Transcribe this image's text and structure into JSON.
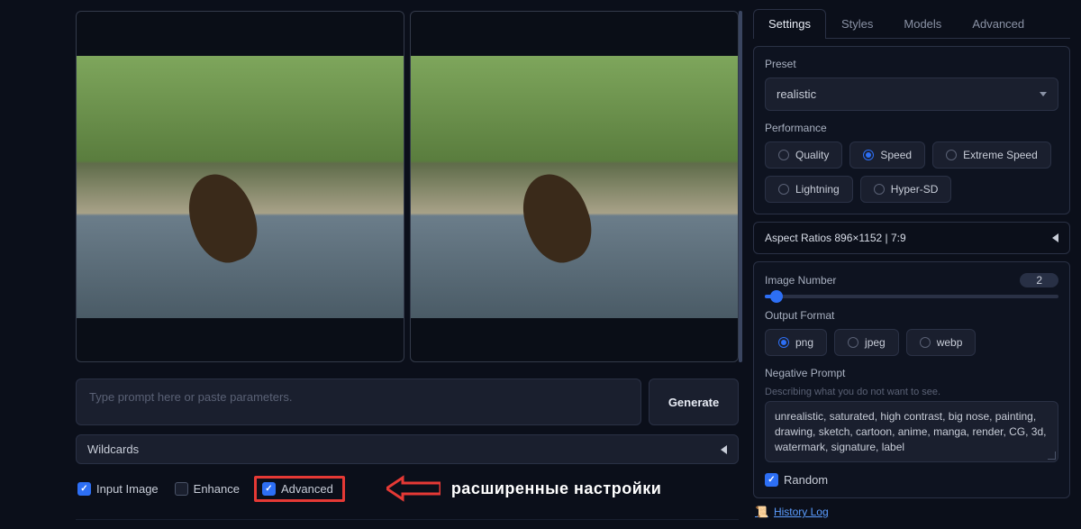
{
  "prompt": {
    "placeholder": "Type prompt here or paste parameters.",
    "generate_label": "Generate"
  },
  "wildcards_label": "Wildcards",
  "checkboxes": {
    "input_image": "Input Image",
    "enhance": "Enhance",
    "advanced": "Advanced"
  },
  "annotation": {
    "text": "расширенные настройки"
  },
  "right_tabs": [
    "Settings",
    "Styles",
    "Models",
    "Advanced"
  ],
  "preset": {
    "label": "Preset",
    "value": "realistic"
  },
  "performance": {
    "label": "Performance",
    "options": [
      "Quality",
      "Speed",
      "Extreme Speed",
      "Lightning",
      "Hyper-SD"
    ],
    "selected": "Speed"
  },
  "aspect_ratio": {
    "label": "Aspect Ratios 896×1152 | 7:9"
  },
  "image_number": {
    "label": "Image Number",
    "value": "2"
  },
  "output_format": {
    "label": "Output Format",
    "options": [
      "png",
      "jpeg",
      "webp"
    ],
    "selected": "png"
  },
  "negative_prompt": {
    "label": "Negative Prompt",
    "hint": "Describing what you do not want to see.",
    "value": "unrealistic, saturated, high contrast, big nose, painting, drawing, sketch, cartoon, anime, manga, render, CG, 3d, watermark, signature, label"
  },
  "random": {
    "label": "Random"
  },
  "history_log": "History Log"
}
